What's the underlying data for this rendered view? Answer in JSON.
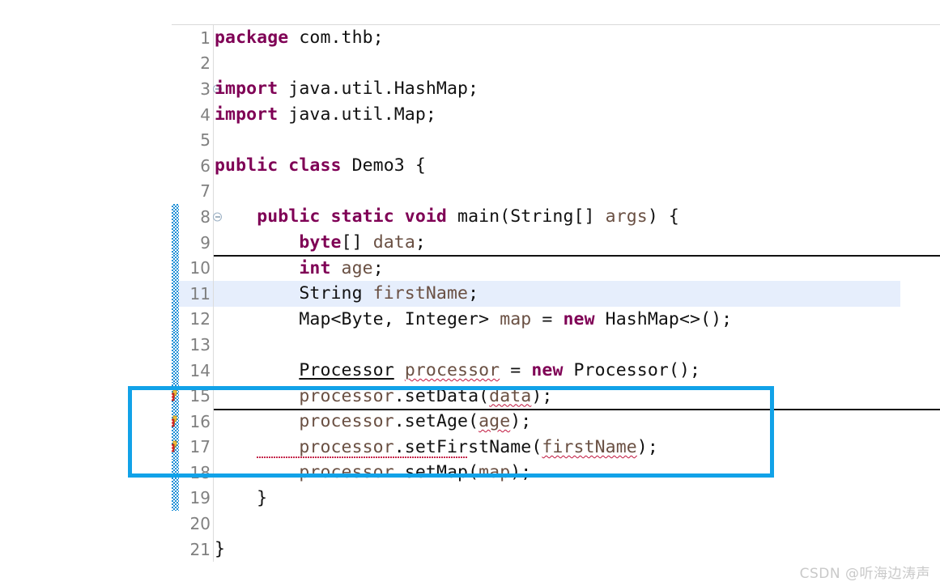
{
  "editor": {
    "file_language": "java",
    "colors": {
      "keyword": "#7f0055",
      "local_variable": "#6a5043",
      "plain_text": "#111111",
      "line_number": "#808080",
      "current_line_highlight": "#e6eefc",
      "error_squiggle": "#c0143c",
      "change_bar": "#1e8fd6",
      "annotation_box": "#11a2e8"
    },
    "lines": [
      {
        "num": "1",
        "fold": false,
        "marker": "none",
        "change": false,
        "highlight": false,
        "tokens": [
          {
            "t": "package",
            "c": "kw"
          },
          {
            "t": " com.thb;",
            "c": "plain"
          }
        ]
      },
      {
        "num": "2",
        "fold": false,
        "marker": "none",
        "change": false,
        "highlight": false,
        "tokens": []
      },
      {
        "num": "3",
        "fold": true,
        "marker": "none",
        "change": false,
        "highlight": false,
        "tokens": [
          {
            "t": "import",
            "c": "kw"
          },
          {
            "t": " java.util.HashMap;",
            "c": "plain"
          }
        ]
      },
      {
        "num": "4",
        "fold": false,
        "marker": "none",
        "change": false,
        "highlight": false,
        "tokens": [
          {
            "t": "import",
            "c": "kw"
          },
          {
            "t": " java.util.Map;",
            "c": "plain"
          }
        ]
      },
      {
        "num": "5",
        "fold": false,
        "marker": "none",
        "change": false,
        "highlight": false,
        "tokens": []
      },
      {
        "num": "6",
        "fold": false,
        "marker": "none",
        "change": false,
        "highlight": false,
        "tokens": [
          {
            "t": "public class",
            "c": "kw"
          },
          {
            "t": " Demo3 {",
            "c": "plain"
          }
        ]
      },
      {
        "num": "7",
        "fold": false,
        "marker": "none",
        "change": false,
        "highlight": false,
        "tokens": []
      },
      {
        "num": "8",
        "fold": true,
        "marker": "none",
        "change": true,
        "highlight": false,
        "tokens": [
          {
            "t": "    ",
            "c": "plain"
          },
          {
            "t": "public static void",
            "c": "kw"
          },
          {
            "t": " main(String[] ",
            "c": "plain"
          },
          {
            "t": "args",
            "c": "var"
          },
          {
            "t": ") {",
            "c": "plain"
          }
        ]
      },
      {
        "num": "9",
        "fold": false,
        "marker": "none",
        "change": true,
        "highlight": false,
        "rule_below": true,
        "tokens": [
          {
            "t": "        ",
            "c": "plain"
          },
          {
            "t": "byte",
            "c": "kw"
          },
          {
            "t": "[] ",
            "c": "plain"
          },
          {
            "t": "data",
            "c": "var"
          },
          {
            "t": ";",
            "c": "plain"
          }
        ]
      },
      {
        "num": "10",
        "fold": false,
        "marker": "none",
        "change": true,
        "highlight": false,
        "tokens": [
          {
            "t": "        ",
            "c": "plain"
          },
          {
            "t": "int",
            "c": "kw"
          },
          {
            "t": " ",
            "c": "plain"
          },
          {
            "t": "age",
            "c": "var"
          },
          {
            "t": ";",
            "c": "plain"
          }
        ]
      },
      {
        "num": "11",
        "fold": false,
        "marker": "none",
        "change": true,
        "highlight": true,
        "tokens": [
          {
            "t": "        String ",
            "c": "plain"
          },
          {
            "t": "firstName",
            "c": "var"
          },
          {
            "t": ";",
            "c": "plain"
          }
        ]
      },
      {
        "num": "12",
        "fold": false,
        "marker": "none",
        "change": true,
        "highlight": false,
        "tokens": [
          {
            "t": "        Map<Byte, Integer> ",
            "c": "plain"
          },
          {
            "t": "map",
            "c": "var"
          },
          {
            "t": " = ",
            "c": "plain"
          },
          {
            "t": "new",
            "c": "kw"
          },
          {
            "t": " HashMap<>();",
            "c": "plain"
          }
        ]
      },
      {
        "num": "13",
        "fold": false,
        "marker": "none",
        "change": true,
        "highlight": false,
        "tokens": []
      },
      {
        "num": "14",
        "fold": false,
        "marker": "none",
        "change": true,
        "highlight": false,
        "tokens": [
          {
            "t": "        ",
            "c": "plain"
          },
          {
            "t": "Processor",
            "c": "plain sl-und"
          },
          {
            "t": " ",
            "c": "plain"
          },
          {
            "t": "processor",
            "c": "var wavy"
          },
          {
            "t": " = ",
            "c": "plain"
          },
          {
            "t": "new",
            "c": "kw"
          },
          {
            "t": " Processor();",
            "c": "plain"
          }
        ]
      },
      {
        "num": "15",
        "fold": false,
        "marker": "error-quickfix",
        "change": true,
        "highlight": false,
        "rule_below": true,
        "tokens": [
          {
            "t": "        ",
            "c": "plain"
          },
          {
            "t": "processor",
            "c": "var"
          },
          {
            "t": ".setData(",
            "c": "plain"
          },
          {
            "t": "data",
            "c": "var wavy"
          },
          {
            "t": ");",
            "c": "plain"
          }
        ]
      },
      {
        "num": "16",
        "fold": false,
        "marker": "error-quickfix",
        "change": true,
        "highlight": false,
        "tokens": [
          {
            "t": "        ",
            "c": "plain"
          },
          {
            "t": "processor",
            "c": "var"
          },
          {
            "t": ".setAge(",
            "c": "plain"
          },
          {
            "t": "age",
            "c": "var wavy"
          },
          {
            "t": ");",
            "c": "plain"
          }
        ]
      },
      {
        "num": "17",
        "fold": false,
        "marker": "error-quickfix",
        "change": true,
        "highlight": false,
        "wavy_below": true,
        "tokens": [
          {
            "t": "        ",
            "c": "plain"
          },
          {
            "t": "processor",
            "c": "var"
          },
          {
            "t": ".setFirstName(",
            "c": "plain"
          },
          {
            "t": "firstName",
            "c": "var wavy"
          },
          {
            "t": ");",
            "c": "plain"
          }
        ]
      },
      {
        "num": "18",
        "fold": false,
        "marker": "none",
        "change": true,
        "highlight": false,
        "tokens": [
          {
            "t": "        ",
            "c": "plain"
          },
          {
            "t": "processor",
            "c": "var"
          },
          {
            "t": ".setMap(",
            "c": "plain"
          },
          {
            "t": "map",
            "c": "var"
          },
          {
            "t": ");",
            "c": "plain"
          }
        ]
      },
      {
        "num": "19",
        "fold": false,
        "marker": "none",
        "change": true,
        "highlight": false,
        "tokens": [
          {
            "t": "    }",
            "c": "plain"
          }
        ]
      },
      {
        "num": "20",
        "fold": false,
        "marker": "none",
        "change": false,
        "highlight": false,
        "tokens": []
      },
      {
        "num": "21",
        "fold": false,
        "marker": "none",
        "change": false,
        "highlight": false,
        "tokens": [
          {
            "t": "}",
            "c": "plain"
          }
        ]
      }
    ]
  },
  "annotation_box": {
    "label": "highlight-rectangle-lines-15-17"
  },
  "watermark": {
    "text": "CSDN @听海边涛声"
  }
}
